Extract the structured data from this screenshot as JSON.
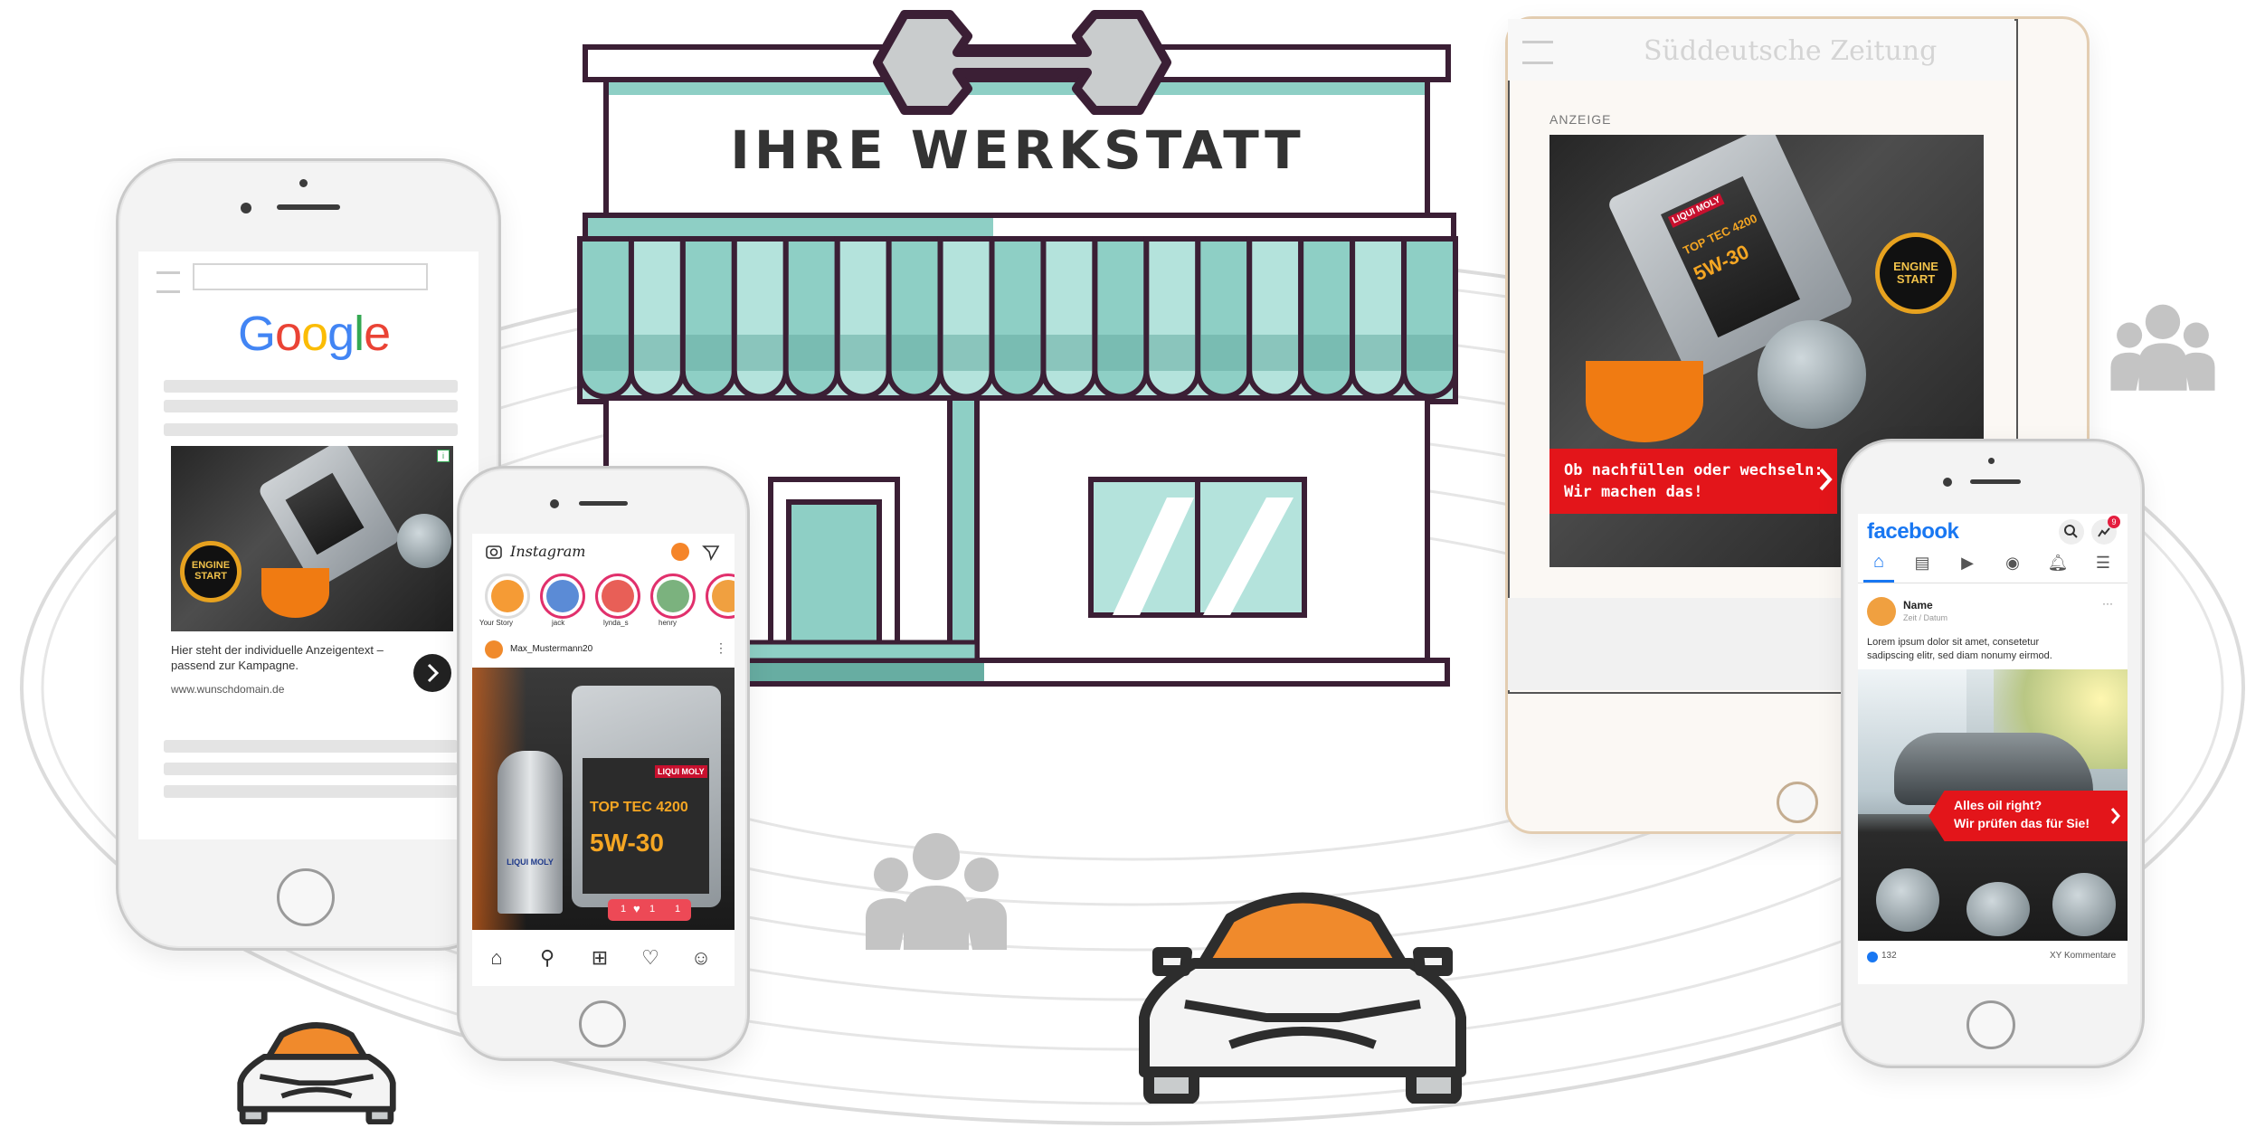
{
  "colors": {
    "teal": "#8ecfc5",
    "teal_dark": "#67ada2",
    "outline": "#3b1f35",
    "orange": "#f08a2c",
    "red": "#e3151a",
    "facebook_blue": "#1877f2",
    "gray_icon": "#c4c4c4"
  },
  "workshop": {
    "sign": "IHRE WERKSTATT",
    "icons": [
      "wrench-icon"
    ]
  },
  "google_phone": {
    "logo": "Google",
    "ad_text": "Hier steht der individuelle Anzeigentext – passend zur Kampagne.",
    "ad_url": "www.wunschdomain.de",
    "next_icon": "chevron-right-icon",
    "badge": "ENGINE START"
  },
  "instagram_phone": {
    "brand": "Instagram",
    "stories": [
      "Your Story",
      "jack",
      "lynda_s",
      "henry"
    ],
    "post_user": "Max_Mustermann20",
    "oil_brand": "LIQUI MOLY",
    "oil_product": "TOP TEC 4200",
    "oil_grade": "5W-30",
    "bottle_label": "LIQUI MOLY",
    "likes_popup": [
      "1",
      "1",
      "1"
    ]
  },
  "tablet": {
    "masthead": "Süddeutsche Zeitung",
    "ad_label": "ANZEIGE",
    "banner_text_line1": "Ob nachfüllen oder wechseln:",
    "banner_text_line2": "Wir machen das!",
    "badge": "ENGINE START",
    "oil_brand": "LIQUI MOLY",
    "oil_product": "TOP TEC 4200",
    "oil_grade": "5W-30"
  },
  "facebook_phone": {
    "brand": "facebook",
    "notification_count": "9",
    "post_name": "Name",
    "post_meta": "Zeit / Datum",
    "post_text_line1": "Lorem ipsum dolor sit amet, consetetur",
    "post_text_line2": "sadipscing elitr, sed diam nonumy eirmod.",
    "banner_line1": "Alles oil right?",
    "banner_line2": "Wir prüfen das für Sie!",
    "likes": "132",
    "comments": "XY Kommentare"
  }
}
